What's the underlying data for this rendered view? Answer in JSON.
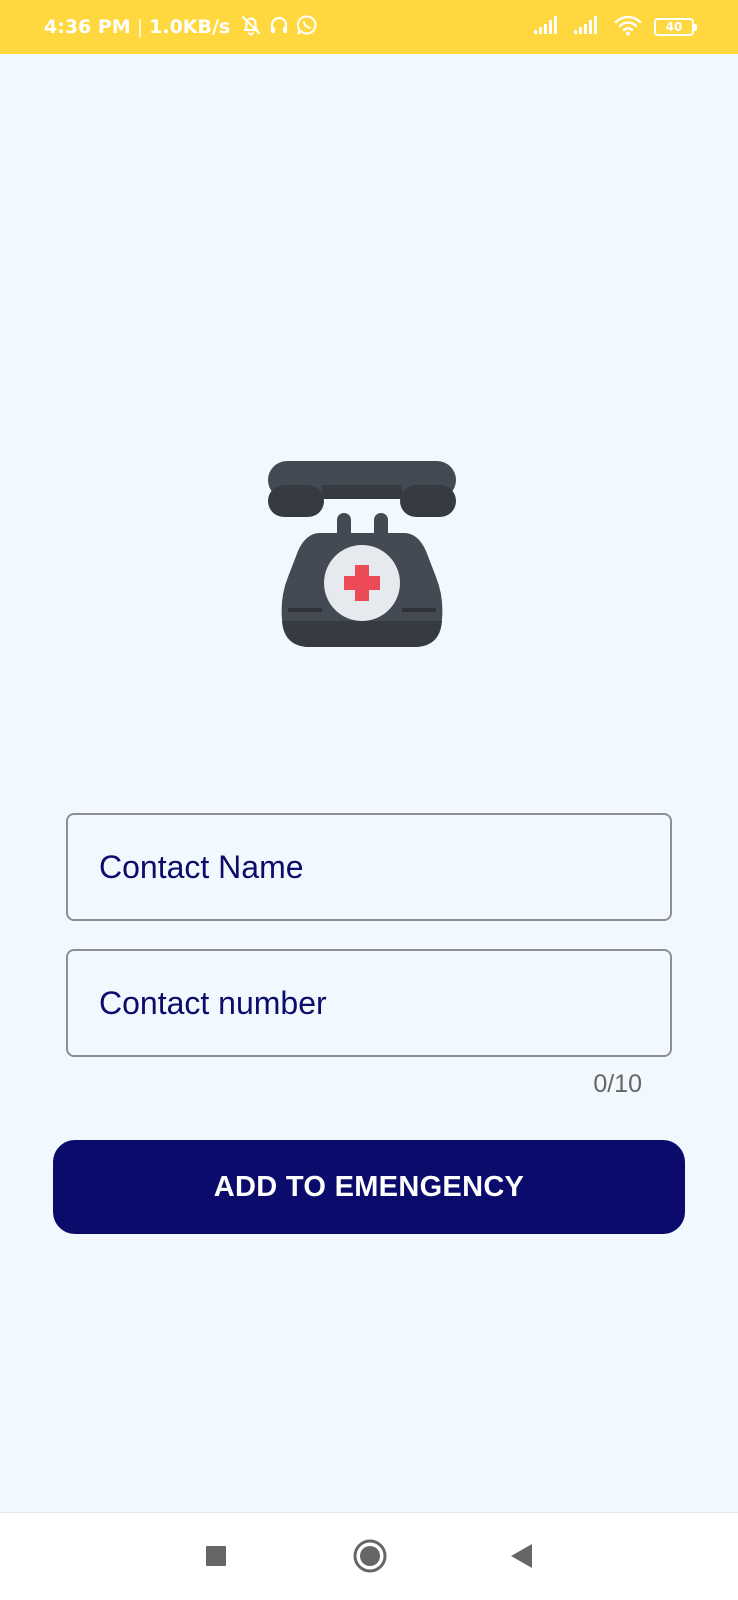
{
  "status_bar": {
    "time": "4:36 PM",
    "separator": "|",
    "net_speed": "1.0KB/s",
    "battery_level": "40",
    "icons": [
      "bell-off-icon",
      "headset-icon",
      "whatsapp-icon",
      "signal-icon",
      "signal-icon",
      "wifi-icon",
      "battery-icon"
    ],
    "background_color": "#ffd83f"
  },
  "logo": {
    "icon": "emergency-phone-icon"
  },
  "form": {
    "contact_name_placeholder": "Contact Name",
    "contact_name_value": "",
    "contact_number_placeholder": "Contact number",
    "contact_number_value": "",
    "char_counter": "0/10"
  },
  "actions": {
    "add_button_label": "ADD TO EMENGENCY",
    "button_color": "#0b0b6b"
  },
  "nav_bar": {
    "icons": [
      "recents-square-icon",
      "home-circle-icon",
      "back-triangle-icon"
    ]
  }
}
